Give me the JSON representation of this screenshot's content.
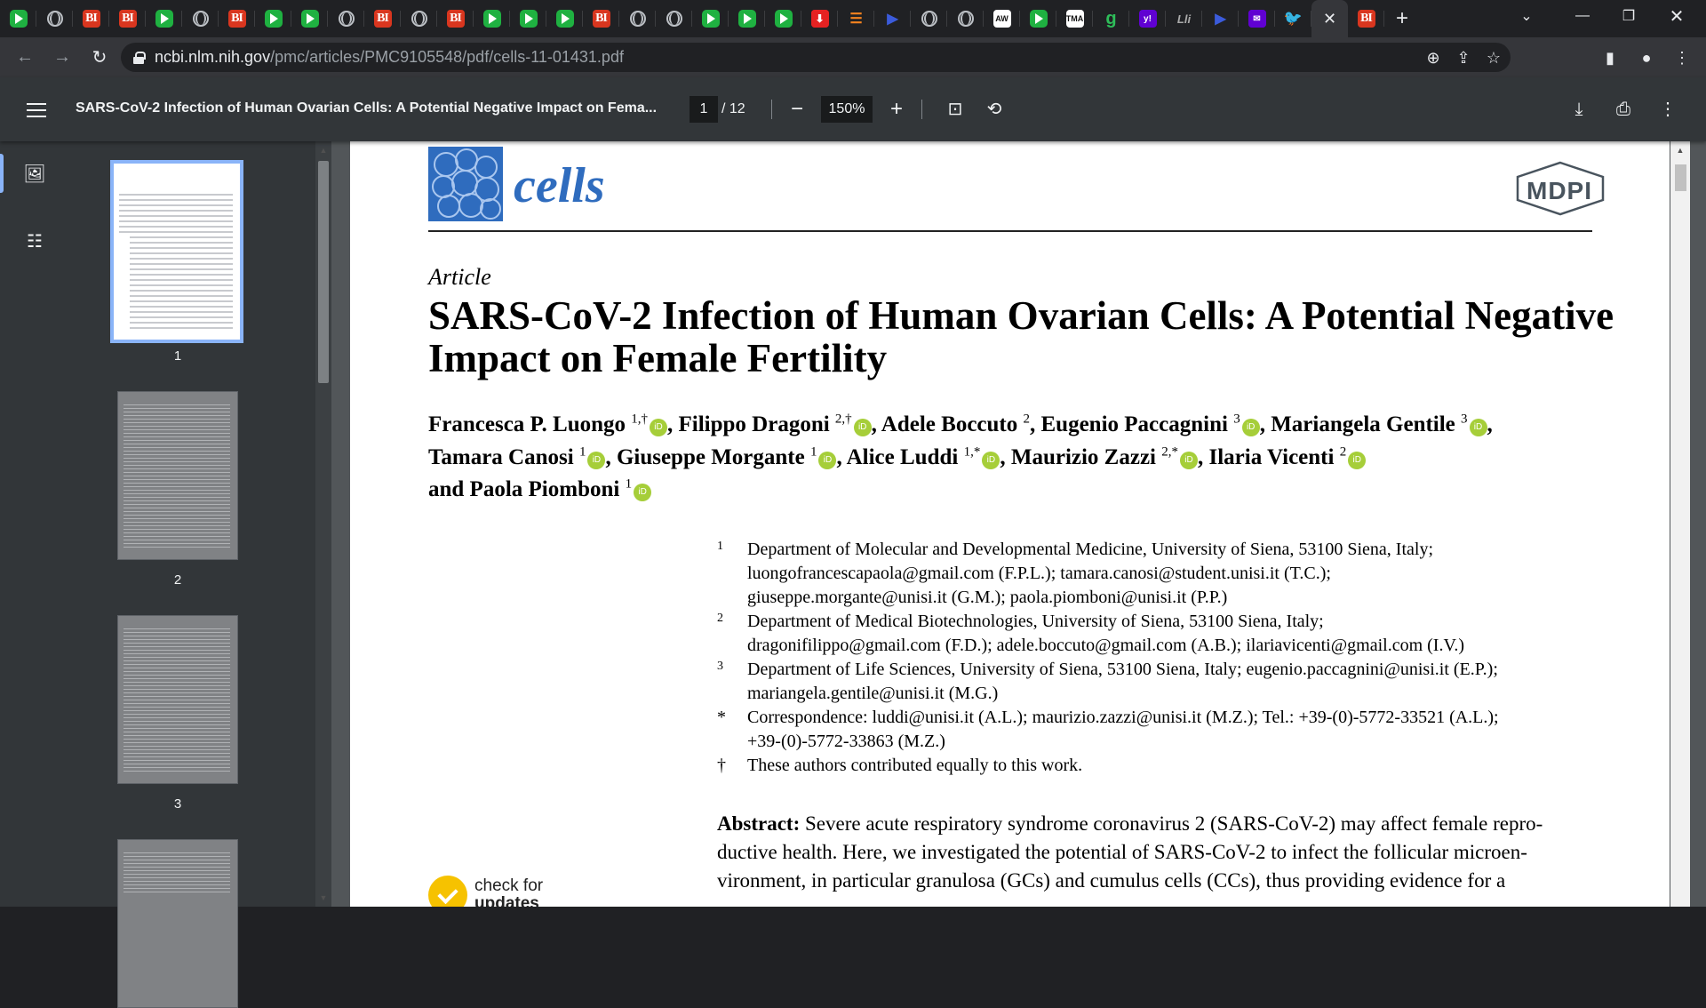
{
  "browser": {
    "tabs": [
      {
        "icon": "play-icon",
        "label": ""
      },
      {
        "icon": "globe-icon",
        "label": ""
      },
      {
        "icon": "bi-icon",
        "label": "BI"
      },
      {
        "icon": "bi-icon",
        "label": "BI"
      },
      {
        "icon": "play-icon",
        "label": ""
      },
      {
        "icon": "globe-icon",
        "label": ""
      },
      {
        "icon": "bi-icon",
        "label": "BI"
      },
      {
        "icon": "play-icon",
        "label": ""
      },
      {
        "icon": "play-icon",
        "label": ""
      },
      {
        "icon": "globe-icon",
        "label": ""
      },
      {
        "icon": "bi-icon",
        "label": "BI"
      },
      {
        "icon": "globe-icon",
        "label": ""
      },
      {
        "icon": "bi-icon",
        "label": "BI"
      },
      {
        "icon": "play-icon",
        "label": ""
      },
      {
        "icon": "play-icon",
        "label": ""
      },
      {
        "icon": "play-icon",
        "label": ""
      },
      {
        "icon": "bi-icon",
        "label": "BI"
      },
      {
        "icon": "globe-icon",
        "label": ""
      },
      {
        "icon": "globe-icon",
        "label": ""
      },
      {
        "icon": "play-icon",
        "label": ""
      },
      {
        "icon": "play-icon",
        "label": ""
      },
      {
        "icon": "play-icon",
        "label": ""
      },
      {
        "icon": "download-red-icon",
        "label": ""
      },
      {
        "icon": "bookmark-orange-icon",
        "label": ""
      },
      {
        "icon": "forward-blue-icon",
        "label": ""
      },
      {
        "icon": "globe-icon",
        "label": ""
      },
      {
        "icon": "globe-icon",
        "label": ""
      },
      {
        "icon": "box-icon",
        "label": "AW"
      },
      {
        "icon": "play-icon",
        "label": ""
      },
      {
        "icon": "box-icon",
        "label": "TMA"
      },
      {
        "icon": "g-icon",
        "label": "g"
      },
      {
        "icon": "yahoo-icon",
        "label": "y!"
      },
      {
        "icon": "lc-icon",
        "label": "Lli"
      },
      {
        "icon": "forward-blue-icon",
        "label": ""
      },
      {
        "icon": "mail-icon",
        "label": ""
      },
      {
        "icon": "twitter-icon",
        "label": ""
      },
      {
        "icon": "close-icon",
        "label": "✕"
      },
      {
        "icon": "bi-icon",
        "label": "BI"
      }
    ],
    "url_host": "ncbi.nlm.nih.gov",
    "url_path": "/pmc/articles/PMC9105548/pdf/cells-11-01431.pdf"
  },
  "viewer": {
    "title": "SARS-CoV-2 Infection of Human Ovarian Cells: A Potential Negative Impact on Fema...",
    "page_current": "1",
    "page_total": "/ 12",
    "zoom": "150%",
    "thumbnails": [
      "1",
      "2",
      "3"
    ]
  },
  "doc": {
    "journal": "cells",
    "publisher": "MDPI",
    "article_type": "Article",
    "title": "SARS-CoV-2 Infection of Human Ovarian Cells: A Potential Negative Impact on Female Fertility",
    "authors": [
      {
        "name": "Francesca P. Luongo",
        "sup": "1,†",
        "orcid": true,
        "sep": ","
      },
      {
        "name": "Filippo Dragoni",
        "sup": "2,†",
        "orcid": true,
        "sep": ","
      },
      {
        "name": "Adele Boccuto",
        "sup": "2",
        "orcid": false,
        "sep": ","
      },
      {
        "name": "Eugenio Paccagnini",
        "sup": "3",
        "orcid": true,
        "sep": ","
      },
      {
        "name": "Mariangela Gentile",
        "sup": "3",
        "orcid": true,
        "sep": ","
      },
      {
        "name": "Tamara Canosi",
        "sup": "1",
        "orcid": true,
        "sep": ","
      },
      {
        "name": "Giuseppe Morgante",
        "sup": "1",
        "orcid": true,
        "sep": ","
      },
      {
        "name": "Alice Luddi",
        "sup": "1,*",
        "orcid": true,
        "sep": ","
      },
      {
        "name": "Maurizio Zazzi",
        "sup": "2,*",
        "orcid": true,
        "sep": ","
      },
      {
        "name": "Ilaria Vicenti",
        "sup": "2",
        "orcid": true,
        "sep": ""
      },
      {
        "name": "and Paola Piomboni",
        "sup": "1",
        "orcid": true,
        "sep": ""
      }
    ],
    "orcid_label": "iD",
    "affiliations": [
      {
        "mark": "1",
        "lines": [
          "Department of Molecular and Developmental Medicine, University of Siena, 53100 Siena, Italy;",
          "luongofrancescapaola@gmail.com (F.P.L.); tamara.canosi@student.unisi.it (T.C.);",
          "giuseppe.morgante@unisi.it (G.M.); paola.piomboni@unisi.it (P.P.)"
        ]
      },
      {
        "mark": "2",
        "lines": [
          "Department of Medical Biotechnologies, University of Siena, 53100 Siena, Italy;",
          "dragonifilippo@gmail.com (F.D.); adele.boccuto@gmail.com (A.B.); ilariavicenti@gmail.com (I.V.)"
        ]
      },
      {
        "mark": "3",
        "lines": [
          "Department of Life Sciences, University of Siena, 53100 Siena, Italy; eugenio.paccagnini@unisi.it (E.P.);",
          "mariangela.gentile@unisi.it (M.G.)"
        ]
      },
      {
        "mark": "*",
        "lines": [
          "Correspondence: luddi@unisi.it (A.L.); maurizio.zazzi@unisi.it (M.Z.); Tel.: +39-(0)-5772-33521 (A.L.);",
          "+39-(0)-5772-33863 (M.Z.)"
        ]
      },
      {
        "mark": "†",
        "lines": [
          "These authors contributed equally to this work."
        ]
      }
    ],
    "abstract_label": "Abstract:",
    "abstract_lines": [
      "Severe acute respiratory syndrome coronavirus 2 (SARS-CoV-2) may affect female repro-",
      "ductive health. Here, we investigated the potential of SARS-CoV-2 to infect the follicular microen-",
      "vironment, in particular granulosa (GCs) and cumulus cells (CCs), thus providing evidence for a"
    ],
    "check_line1": "check for",
    "check_line2": "updates"
  }
}
